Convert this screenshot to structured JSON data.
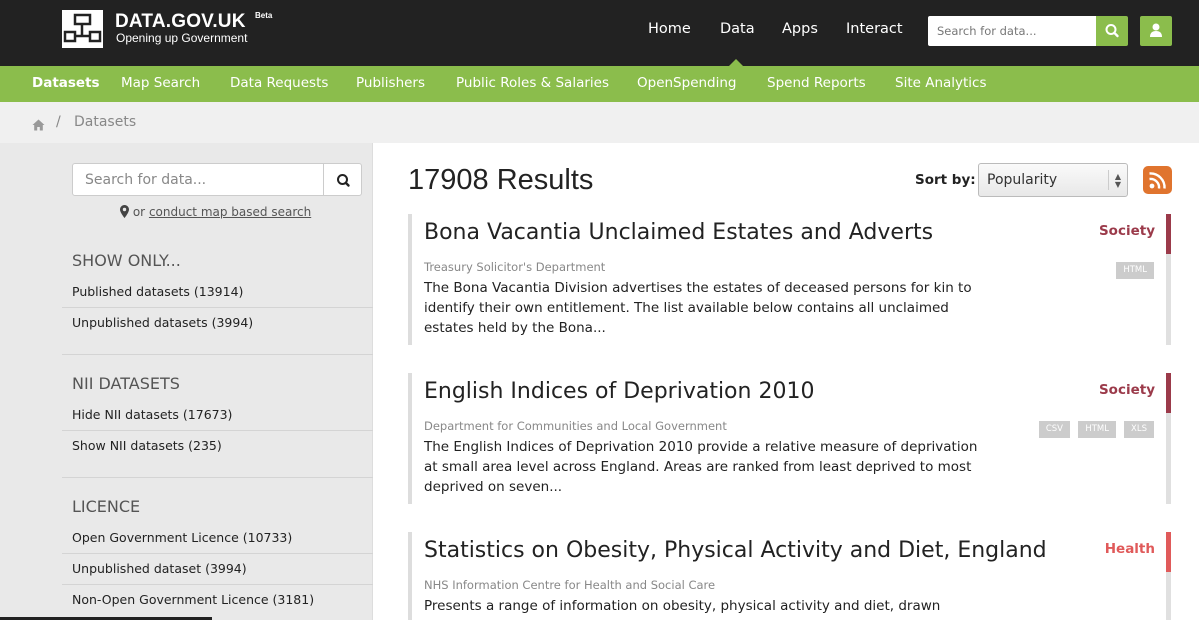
{
  "header": {
    "logo_title": "DATA.GOV.UK",
    "logo_beta": "Beta",
    "logo_tagline": "Opening up Government",
    "nav": [
      "Home",
      "Data",
      "Apps",
      "Interact"
    ],
    "search_placeholder": "Search for data..."
  },
  "subnav": {
    "items": [
      "Datasets",
      "Map Search",
      "Data Requests",
      "Publishers",
      "Public Roles & Salaries",
      "OpenSpending",
      "Spend Reports",
      "Site Analytics"
    ]
  },
  "breadcrumb": {
    "separator": "/",
    "current": "Datasets"
  },
  "sidebar": {
    "search_placeholder": "Search for data...",
    "map_prefix": "or",
    "map_link": "conduct map based search",
    "sections": [
      {
        "title": "SHOW ONLY...",
        "items": [
          "Published datasets (13914)",
          "Unpublished datasets (3994)"
        ]
      },
      {
        "title": "NII DATASETS",
        "items": [
          "Hide NII datasets (17673)",
          "Show NII datasets (235)"
        ]
      },
      {
        "title": "LICENCE",
        "items": [
          "Open Government Licence (10733)",
          "Unpublished dataset (3994)",
          "Non-Open Government Licence (3181)"
        ]
      }
    ]
  },
  "main": {
    "results_count": "17908 Results",
    "sort_label": "Sort by:",
    "sort_value": "Popularity",
    "results": [
      {
        "title": "Bona Vacantia Unclaimed Estates and Adverts",
        "publisher": "Treasury Solicitor's Department",
        "description": "The Bona Vacantia Division advertises the estates of deceased persons for kin to identify their own entitlement. The list available below contains all unclaimed estates held by the Bona...",
        "category": "Society",
        "formats": [
          "HTML"
        ]
      },
      {
        "title": "English Indices of Deprivation 2010",
        "publisher": "Department for Communities and Local Government",
        "description": "The English Indices of Deprivation 2010 provide a relative measure of deprivation at small area level across England. Areas are ranked from least deprived to most deprived on seven...",
        "category": "Society",
        "formats": [
          "CSV",
          "HTML",
          "XLS"
        ]
      },
      {
        "title": "Statistics on Obesity, Physical Activity and Diet, England",
        "publisher": "NHS Information Centre for Health and Social Care",
        "description": "Presents a range of information on obesity, physical activity and diet, drawn",
        "category": "Health",
        "formats": []
      }
    ]
  },
  "colors": {
    "green": "#8bbd4c",
    "dark": "#222222",
    "society": "#9b3a4a",
    "health": "#e05a5a",
    "rss": "#e0742e"
  }
}
